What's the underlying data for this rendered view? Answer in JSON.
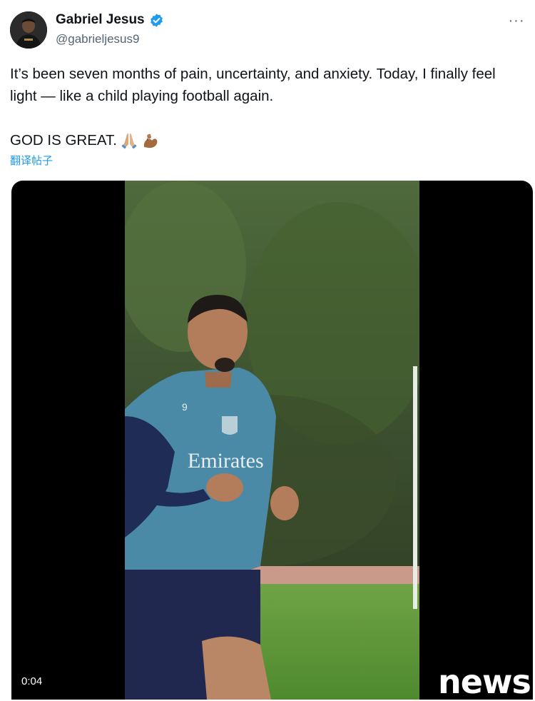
{
  "author": {
    "display_name": "Gabriel Jesus",
    "handle": "@gabrieljesus9",
    "verified_icon": "verified-badge-icon",
    "avatar_icon": "profile-photo"
  },
  "header": {
    "more_label": "···"
  },
  "tweet": {
    "text_line1": "It’s been seven months of pain, uncertainty, and anxiety. Today, I finally feel light — like a child playing football again.",
    "text_line2": "GOD IS GREAT.",
    "emojis": [
      "praying-hands-emoji",
      "flexed-biceps-emoji"
    ],
    "translate_label": "翻译帖子"
  },
  "media": {
    "timestamp": "0:04",
    "shirt_sponsor": "Emirates",
    "shirt_number": "9"
  },
  "watermark": "news",
  "colors": {
    "link": "#1d9bf0",
    "verified": "#1d9bf0",
    "secondary_text": "#536471",
    "primary_text": "#0f1419"
  }
}
